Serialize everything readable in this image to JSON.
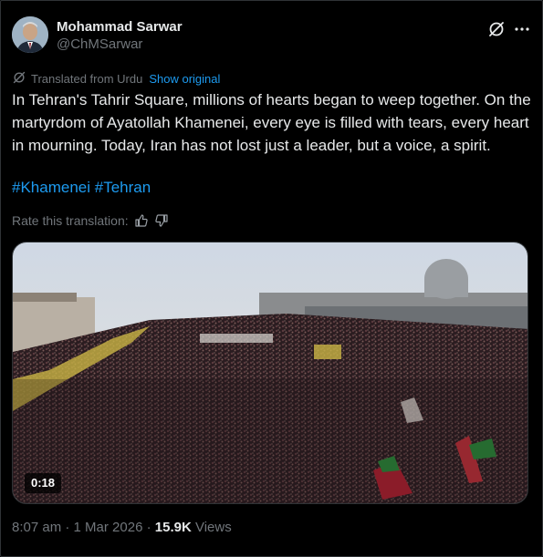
{
  "author": {
    "name": "Mohammad Sarwar",
    "handle": "@ChMSarwar"
  },
  "icons": {
    "avatar": "profile-photo",
    "grok": "grok-icon",
    "more": "more-horizontal-icon",
    "translate": "translate-icon",
    "thumbs_up": "thumbs-up-icon",
    "thumbs_down": "thumbs-down-icon"
  },
  "translation": {
    "label": "Translated from Urdu",
    "show_original": "Show original"
  },
  "tweet": {
    "text": "In Tehran's Tahrir Square, millions of hearts began to weep together. On the martyrdom of Ayatollah Khamenei, every eye is filled with tears, every heart in mourning. Today, Iran has not lost just a leader, but a voice, a spirit.",
    "hashtags": [
      "#Khamenei",
      "#Tehran"
    ]
  },
  "rate": {
    "label": "Rate this translation:"
  },
  "media": {
    "duration": "0:18"
  },
  "meta": {
    "time": "8:07 am",
    "sep": "·",
    "date": "1 Mar 2026",
    "views_count": "15.9K",
    "views_label": "Views"
  },
  "colors": {
    "background": "#000000",
    "text": "#e7e9ea",
    "muted": "#71767b",
    "link": "#1d9bf0"
  }
}
